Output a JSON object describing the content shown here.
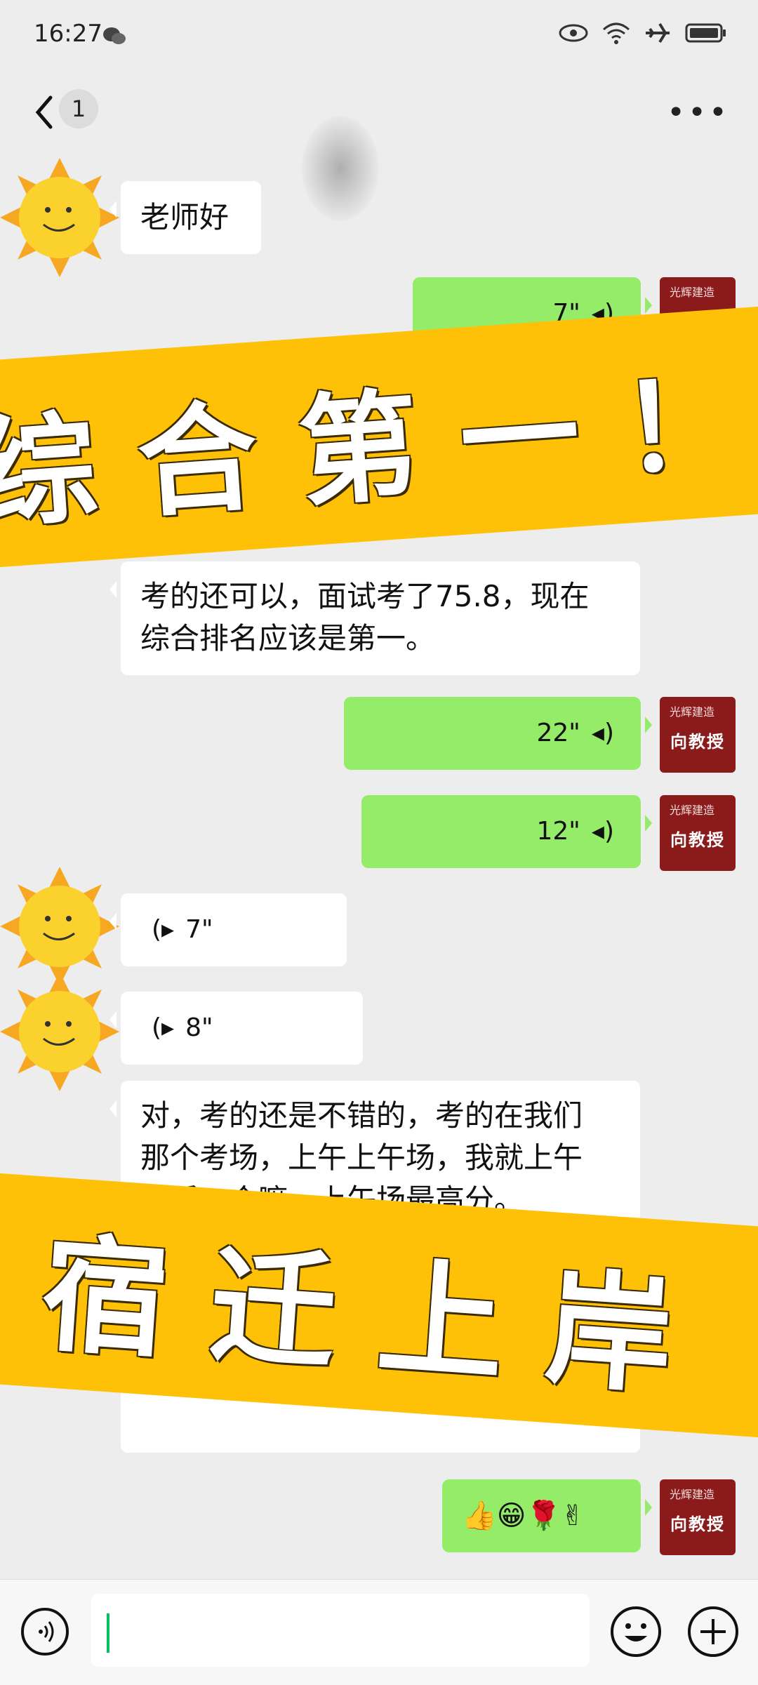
{
  "status_bar": {
    "time": "16:27"
  },
  "nav": {
    "unread_count": "1",
    "more_label": "•••"
  },
  "messages": {
    "m1": "老师好",
    "m2_duration": "7\"",
    "m3_line1": "考的还可以，面试考了75.8，现在",
    "m3_line2": "综合排名应该是第一。",
    "m4_duration": "22\"",
    "m5_duration": "12\"",
    "m6_duration": "7\"",
    "m7_duration": "8\"",
    "m8_line1": "对，考的还是不错的，考的在我们",
    "m8_line2": "那个考场，上午上午场，我就上午",
    "m8_line3": "最后一个嘛，上午场最高分。",
    "m9_emojis": "👍😁🌹✌"
  },
  "teacher_avatar": {
    "name": "向教授",
    "logo": "光辉建造"
  },
  "banners": {
    "top": "综合第一！",
    "bottom": "宿迁上岸"
  },
  "colors": {
    "banner": "#ffc107",
    "outgoing_bubble": "#95ec69",
    "teacher_avatar": "#8b1a1a"
  }
}
